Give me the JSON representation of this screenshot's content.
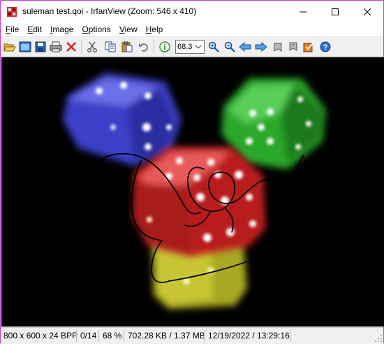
{
  "window": {
    "title": "suleman test.qoi - IrfanView (Zoom: 546 x 410)",
    "border_color": "#c63bd6"
  },
  "menu": [
    {
      "label": "File",
      "underline": "F",
      "rest": "ile"
    },
    {
      "label": "Edit",
      "underline": "E",
      "rest": "dit"
    },
    {
      "label": "Image",
      "underline": "I",
      "rest": "mage"
    },
    {
      "label": "Options",
      "underline": "O",
      "rest": "ptions"
    },
    {
      "label": "View",
      "underline": "V",
      "rest": "iew"
    },
    {
      "label": "Help",
      "underline": "H",
      "rest": "elp"
    }
  ],
  "toolbar": {
    "zoom_value": "68.3",
    "buttons": [
      "open-folder-icon",
      "thumbnails-icon",
      "save-icon",
      "print-icon",
      "delete-icon",
      "cut-icon",
      "copy-icon",
      "paste-icon",
      "undo-icon",
      "info-icon",
      "zoom-in-icon",
      "zoom-out-icon",
      "previous-icon",
      "next-icon",
      "rotate-left-icon",
      "rotate-right-icon",
      "properties-icon",
      "help-icon"
    ]
  },
  "image": {
    "description_colors": {
      "blue": "#3c46d6",
      "green": "#2fb42f",
      "red": "#d4282a",
      "yellow": "#c8c832",
      "pips": "#ffffff"
    }
  },
  "status": {
    "dimensions": "800 x 600 x 24 BPP",
    "index": "0/14",
    "zoom": "68 %",
    "size": "702.28 KB / 1.37 MB",
    "datetime": "12/19/2022 / 13:29:16"
  }
}
